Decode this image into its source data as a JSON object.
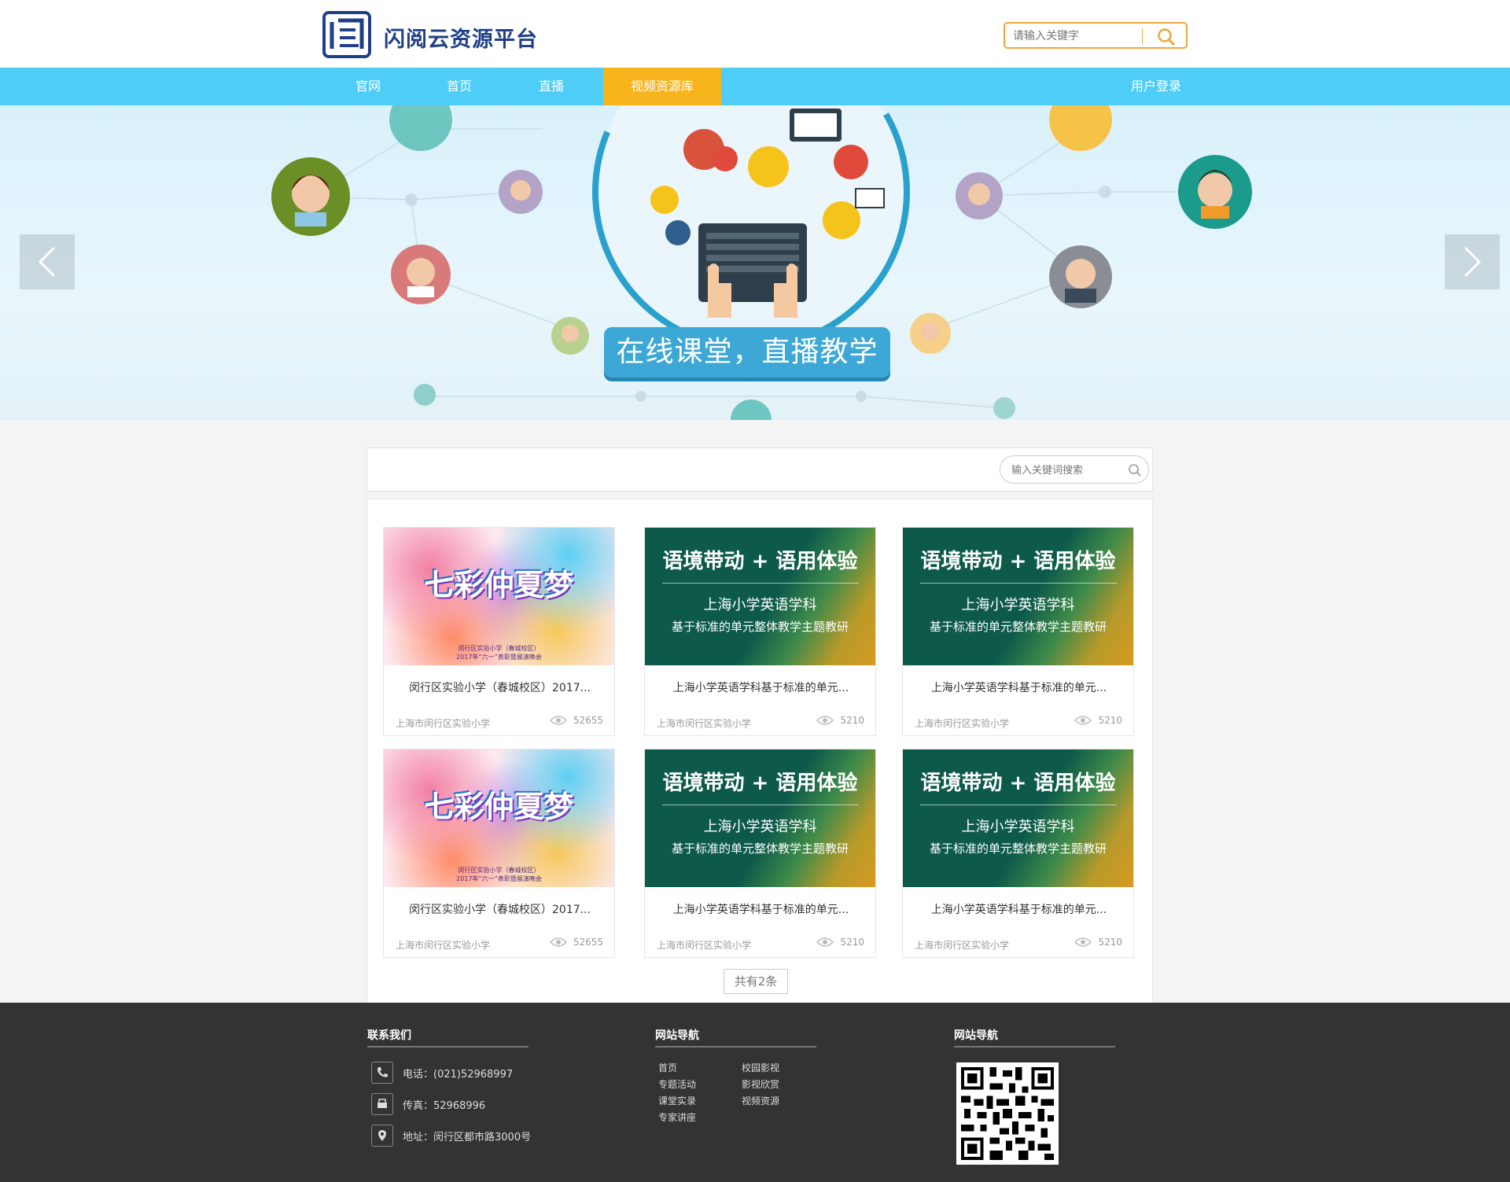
{
  "header": {
    "brand": "闪阅云资源平台",
    "logo_icon": "brand-logo-icon",
    "search_placeholder": "请输入关键字"
  },
  "nav": {
    "items": [
      {
        "label": "官网",
        "active": false
      },
      {
        "label": "首页",
        "active": false
      },
      {
        "label": "直播",
        "active": false
      },
      {
        "label": "视频资源库",
        "active": true
      }
    ],
    "login": "用户登录",
    "colors": {
      "bar": "#4ecdf7",
      "active": "#f7b41d"
    }
  },
  "banner": {
    "slogan": "在线课堂，直播教学",
    "prev_icon": "chevron-left-icon",
    "next_icon": "chevron-right-icon"
  },
  "filter": {
    "search_placeholder": "输入关键词搜索"
  },
  "videos": [
    {
      "thumb": "colorful",
      "title": "闵行区实验小学（春城校区）2017...",
      "org": "上海市闵行区实验小学",
      "views": "52655",
      "thumb_text": {
        "t1": "七彩仲夏梦",
        "t2": "闵行区实验小学（春城校区）",
        "t3": "2017年“六一”表彰暨展演晚会"
      }
    },
    {
      "thumb": "green",
      "title": "上海小学英语学科基于标准的单元...",
      "org": "上海市闵行区实验小学",
      "views": "5210",
      "thumb_text": {
        "t1": "语境带动 + 语用体验",
        "t2": "上海小学英语学科",
        "t3": "基于标准的单元整体教学主题教研"
      }
    },
    {
      "thumb": "green",
      "title": "上海小学英语学科基于标准的单元...",
      "org": "上海市闵行区实验小学",
      "views": "5210",
      "thumb_text": {
        "t1": "语境带动 + 语用体验",
        "t2": "上海小学英语学科",
        "t3": "基于标准的单元整体教学主题教研"
      }
    },
    {
      "thumb": "colorful",
      "title": "闵行区实验小学（春城校区）2017...",
      "org": "上海市闵行区实验小学",
      "views": "52655",
      "thumb_text": {
        "t1": "七彩仲夏梦",
        "t2": "闵行区实验小学（春城校区）",
        "t3": "2017年“六一”表彰暨展演晚会"
      }
    },
    {
      "thumb": "green",
      "title": "上海小学英语学科基于标准的单元...",
      "org": "上海市闵行区实验小学",
      "views": "5210",
      "thumb_text": {
        "t1": "语境带动 + 语用体验",
        "t2": "上海小学英语学科",
        "t3": "基于标准的单元整体教学主题教研"
      }
    },
    {
      "thumb": "green",
      "title": "上海小学英语学科基于标准的单元...",
      "org": "上海市闵行区实验小学",
      "views": "5210",
      "thumb_text": {
        "t1": "语境带动 + 语用体验",
        "t2": "上海小学英语学科",
        "t3": "基于标准的单元整体教学主题教研"
      }
    }
  ],
  "pager": {
    "label": "共有2条"
  },
  "footer": {
    "contact_title": "联系我们",
    "phone": "电话：(021)52968997",
    "fax": "传真：52968996",
    "address": "地址：闵行区都市路3000号",
    "nav_title_1": "网站导航",
    "nav_title_2": "网站导航",
    "links_col1": [
      "首页",
      "专题活动",
      "课堂实录",
      "专家讲座"
    ],
    "links_col2": [
      "校园影视",
      "影视欣赏",
      "视频资源"
    ],
    "qr_icon": "qr-code-icon"
  }
}
